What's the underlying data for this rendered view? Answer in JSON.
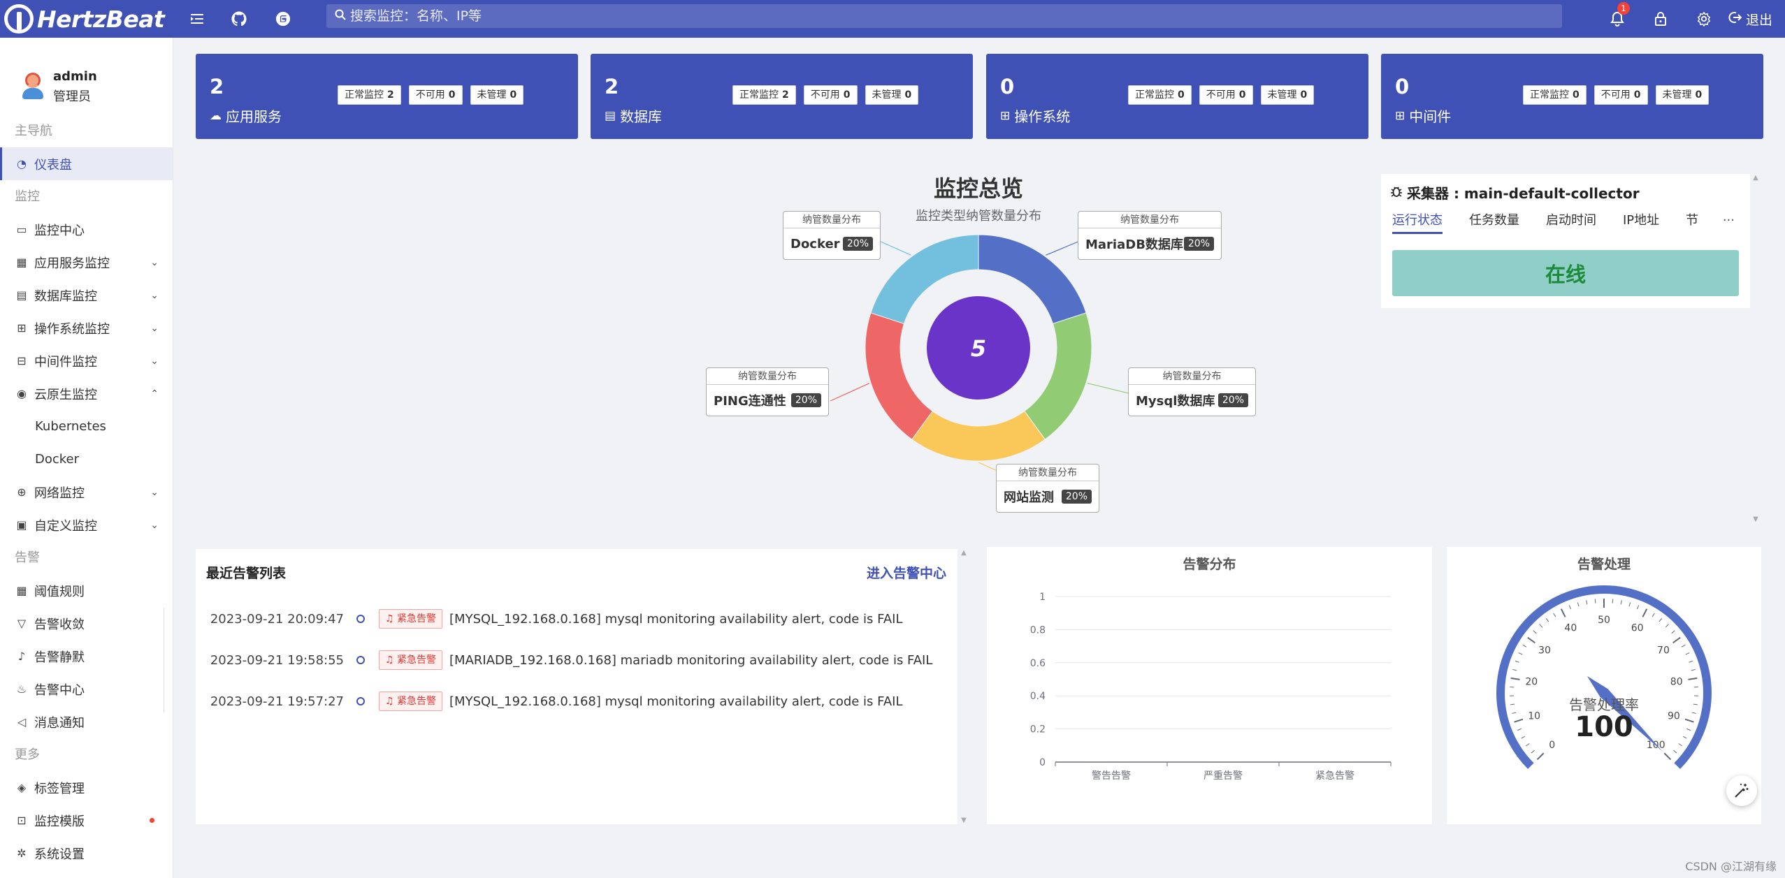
{
  "brand": {
    "name": "HertzBeat"
  },
  "topbar": {
    "search_placeholder": "搜索监控：名称、IP等",
    "notification_count": "1",
    "logout_label": "退出"
  },
  "user": {
    "name": "admin",
    "role": "管理员"
  },
  "sidebar": {
    "group_main": "主导航",
    "dashboard": "仪表盘",
    "group_monitor": "监控",
    "monitor_center": "监控中心",
    "app_service": "应用服务监控",
    "database": "数据库监控",
    "os": "操作系统监控",
    "middleware": "中间件监控",
    "cloud_native": "云原生监控",
    "kubernetes": "Kubernetes",
    "docker": "Docker",
    "network": "网络监控",
    "custom": "自定义监控",
    "group_alert": "告警",
    "threshold": "阈值规则",
    "converge": "告警收敛",
    "silence": "告警静默",
    "alert_center": "告警中心",
    "notice": "消息通知",
    "group_more": "更多",
    "tags": "标签管理",
    "templates": "监控模版",
    "settings": "系统设置"
  },
  "cards": [
    {
      "num": "2",
      "label": "应用服务",
      "icon": "cloud-icon",
      "normal_label": "正常监控",
      "normal": "2",
      "unavail_label": "不可用",
      "unavail": "0",
      "unmanaged_label": "未管理",
      "unmanaged": "0"
    },
    {
      "num": "2",
      "label": "数据库",
      "icon": "database-icon",
      "normal_label": "正常监控",
      "normal": "2",
      "unavail_label": "不可用",
      "unavail": "0",
      "unmanaged_label": "未管理",
      "unmanaged": "0"
    },
    {
      "num": "0",
      "label": "操作系统",
      "icon": "windows-icon",
      "normal_label": "正常监控",
      "normal": "0",
      "unavail_label": "不可用",
      "unavail": "0",
      "unmanaged_label": "未管理",
      "unmanaged": "0"
    },
    {
      "num": "0",
      "label": "中间件",
      "icon": "appstore-icon",
      "normal_label": "正常监控",
      "normal": "0",
      "unavail_label": "不可用",
      "unavail": "0",
      "unmanaged_label": "未管理",
      "unmanaged": "0"
    }
  ],
  "overview": {
    "title": "监控总览",
    "subtitle": "监控类型纳管数量分布",
    "center_value": "5",
    "callout_header": "纳管数量分布"
  },
  "chart_data": [
    {
      "type": "pie",
      "title": "监控总览",
      "subtitle": "监控类型纳管数量分布",
      "categories": [
        "MariaDB数据库",
        "Mysql数据库",
        "网站监测",
        "PING连通性",
        "Docker"
      ],
      "values": [
        1,
        1,
        1,
        1,
        1
      ],
      "labels": [
        "20%",
        "20%",
        "20%",
        "20%",
        "20%"
      ],
      "colors": [
        "#5470c6",
        "#91cc75",
        "#fac858",
        "#ee6666",
        "#73c0de"
      ],
      "total": 5
    },
    {
      "type": "bar",
      "title": "告警分布",
      "categories": [
        "警告告警",
        "严重告警",
        "紧急告警"
      ],
      "values": [
        0,
        0,
        0
      ],
      "ylim": [
        0,
        1
      ],
      "yticks": [
        "1",
        "0.8",
        "0.6",
        "0.4",
        "0.2",
        "0"
      ],
      "grid": true
    },
    {
      "type": "gauge",
      "title": "告警处理",
      "label": "告警处理率",
      "value": 100,
      "range": [
        0,
        100
      ],
      "ticks": [
        "0",
        "10",
        "20",
        "30",
        "40",
        "50",
        "60",
        "70",
        "80",
        "90",
        "100"
      ],
      "color": "#5470c6"
    }
  ],
  "collector": {
    "title": "采集器 : main-default-collector",
    "tabs": [
      "运行状态",
      "任务数量",
      "启动时间",
      "IP地址",
      "节"
    ],
    "more": "···",
    "status": "在线"
  },
  "alerts": {
    "title": "最近告警列表",
    "link": "进入告警中心",
    "items": [
      {
        "time": "2023-09-21 20:09:47",
        "level": "紧急告警",
        "msg": "[MYSQL_192.168.0.168] mysql monitoring availability alert, code is FAIL"
      },
      {
        "time": "2023-09-21 19:58:55",
        "level": "紧急告警",
        "msg": "[MARIADB_192.168.0.168] mariadb monitoring availability alert, code is FAIL"
      },
      {
        "time": "2023-09-21 19:57:27",
        "level": "紧急告警",
        "msg": "[MYSQL_192.168.0.168] mysql monitoring availability alert, code is FAIL"
      }
    ]
  },
  "watermark": "CSDN @江湖有缘"
}
